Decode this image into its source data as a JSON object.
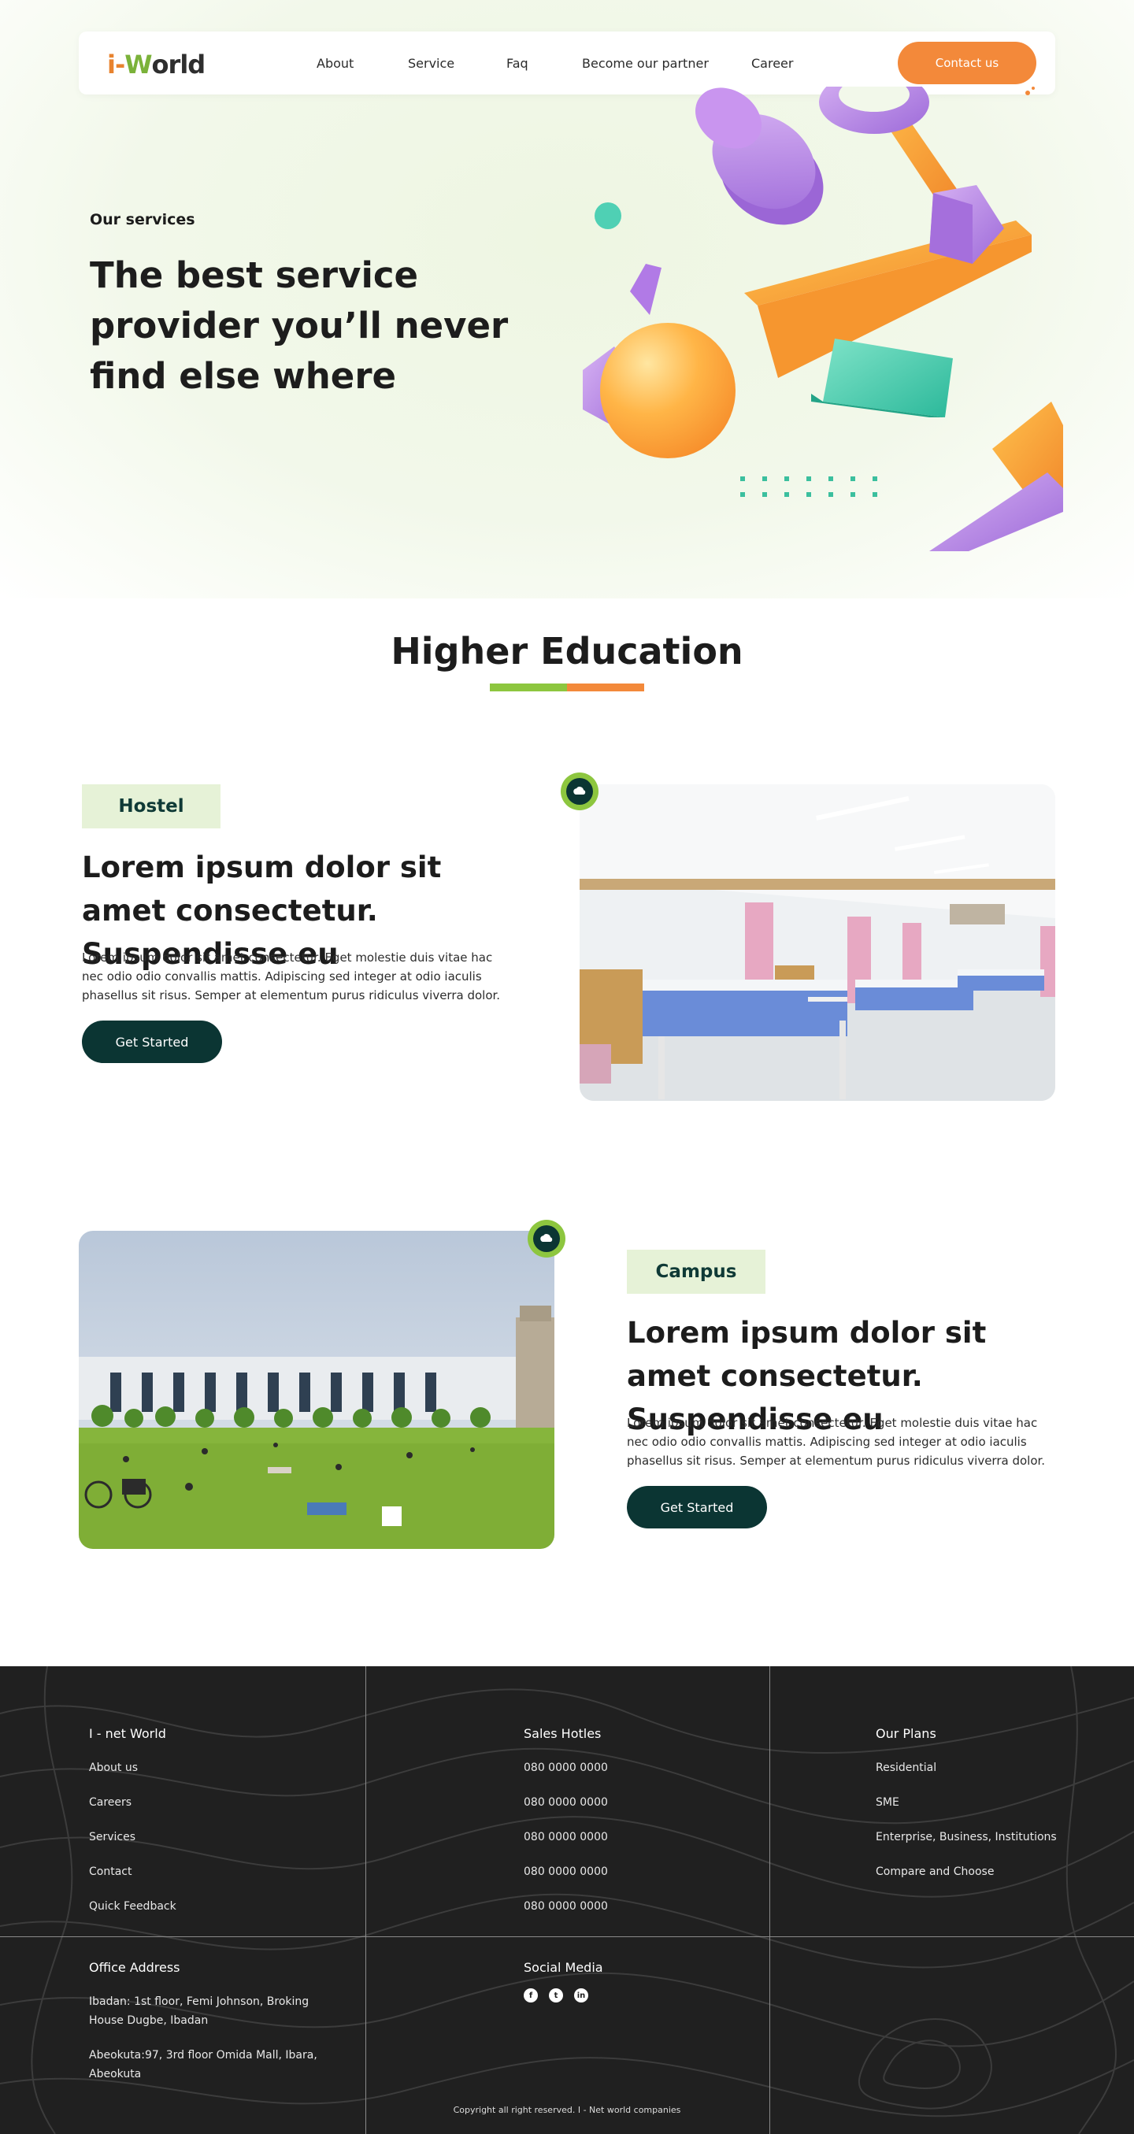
{
  "nav": {
    "logo": {
      "i": "i",
      "dash": "-",
      "w": "W",
      "rest": "orld"
    },
    "links": [
      "About",
      "Service",
      "Faq",
      "Become our partner",
      "Career"
    ],
    "contact": "Contact us"
  },
  "hero": {
    "eyebrow": "Our services",
    "title": "The best service provider you’ll never find else where"
  },
  "section": {
    "title": "Higher Education"
  },
  "features": [
    {
      "tag": "Hostel",
      "heading": "Lorem ipsum dolor sit amet consectetur. Suspendisse eu",
      "body": "Lorem ipsum dolor sit amet consectetur. Eget molestie duis vitae hac nec odio odio convallis mattis. Adipiscing sed integer at odio iaculis phasellus sit risus. Semper at elementum purus ridiculus viverra dolor.",
      "button": "Get Started"
    },
    {
      "tag": "Campus",
      "heading": "Lorem ipsum dolor sit amet consectetur. Suspendisse eu",
      "body": "Lorem ipsum dolor sit amet consectetur. Eget molestie duis vitae hac nec odio odio convallis mattis. Adipiscing sed integer at odio iaculis phasellus sit risus. Semper at elementum purus ridiculus viverra dolor.",
      "button": "Get Started"
    }
  ],
  "footer": {
    "col1": {
      "head": "I - net World",
      "items": [
        "About us",
        "Careers",
        "Services",
        "Contact",
        "Quick Feedback"
      ]
    },
    "col2": {
      "head": "Sales Hotles",
      "items": [
        "080 0000 0000",
        "080 0000 0000",
        "080 0000 0000",
        "080 0000 0000",
        "080 0000 0000"
      ]
    },
    "col3": {
      "head": "Our Plans",
      "items": [
        "Residential",
        "SME",
        "Enterprise, Business, Institutions",
        "Compare and Choose"
      ]
    },
    "office": {
      "head": "Office Address",
      "addr1": "Ibadan: 1st floor, Femi Johnson, Broking House Dugbe, Ibadan",
      "addr2": "Abeokuta:97, 3rd floor Omida Mall, Ibara, Abeokuta"
    },
    "social": {
      "head": "Social Media",
      "icons": [
        "facebook-icon",
        "twitter-icon",
        "linkedin-icon"
      ]
    },
    "copyright": "Copyright all right reserved. I - Net world companies"
  },
  "colors": {
    "accent_orange": "#f3893a",
    "accent_green": "#8dc63f",
    "dark_teal": "#0b3533",
    "footer_bg": "#202020"
  }
}
